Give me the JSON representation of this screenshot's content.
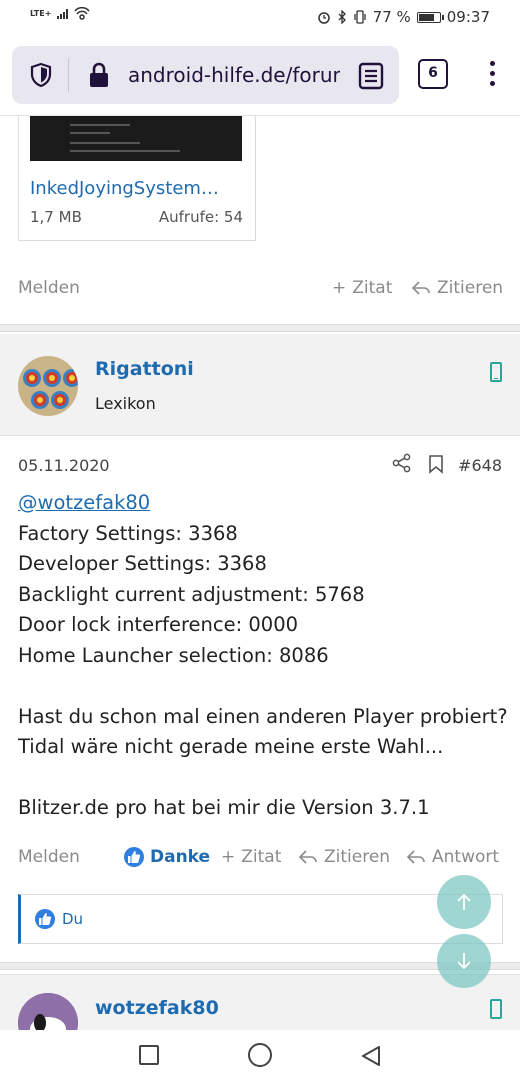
{
  "status_bar": {
    "network": "LTE+",
    "battery": "77 %",
    "battery_level": 0.77,
    "time": "09:37"
  },
  "browser": {
    "url": "android-hilfe.de/forum",
    "tab_count": "6"
  },
  "attachment": {
    "name": "InkedJoyingSystem…",
    "size": "1,7 MB",
    "views": "Aufrufe: 54"
  },
  "prev_post_actions": {
    "report": "Melden",
    "quote": "Zitat",
    "cite": "Zitieren"
  },
  "post": {
    "author": "Rigattoni",
    "role": "Lexikon",
    "date": "05.11.2020",
    "number": "#648",
    "mention": "@wotzefak80",
    "lines": [
      "Factory Settings: 3368",
      "Developer Settings: 3368",
      "Backlight current adjustment: 5768",
      "Door lock interference: 0000",
      "Home Launcher selection: 8086"
    ],
    "paragraph2": [
      "Hast du schon mal einen anderen Player probiert?",
      "Tidal wäre nicht gerade meine erste Wahl..."
    ],
    "paragraph3": "Blitzer.de pro hat bei mir die Version 3.7.1",
    "actions": {
      "report": "Melden",
      "thanks": "Danke",
      "quote": "Zitat",
      "cite": "Zitieren",
      "reply": "Antwort"
    },
    "likes": "Du"
  },
  "next_post": {
    "author": "wotzefak80"
  },
  "colors": {
    "link": "#1f6bb0",
    "accent_teal": "#2aa59a",
    "like_blue": "#2f7fe0"
  }
}
